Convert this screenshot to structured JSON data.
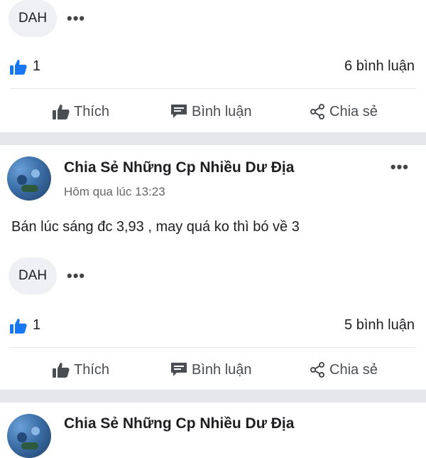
{
  "feed": {
    "posts": [
      {
        "tag": "DAH",
        "likes": "1",
        "comments": "6 bình luận",
        "actions": {
          "like": "Thích",
          "comment": "Bình luận",
          "share": "Chia sẻ"
        }
      },
      {
        "author": "Chia Sẻ Những Cp Nhiều Dư Địa",
        "time": "Hôm qua lúc 13:23",
        "body": "Bán lúc sáng đc 3,93 , may quá ko thì bó về 3",
        "tag": "DAH",
        "likes": "1",
        "comments": "5 bình luận",
        "actions": {
          "like": "Thích",
          "comment": "Bình luận",
          "share": "Chia sẻ"
        }
      },
      {
        "author": "Chia Sẻ Những Cp Nhiều Dư Địa"
      }
    ]
  },
  "colors": {
    "like_blue": "#1877f2",
    "action_gray": "#4a4d52",
    "separator": "#e4e6e9"
  },
  "icons": {
    "more": "more-horizontal-icon",
    "like_reaction": "thumbs-up-reaction-icon",
    "like_action": "thumbs-up-outline-icon",
    "comment": "speech-bubble-icon",
    "share": "share-icon"
  }
}
